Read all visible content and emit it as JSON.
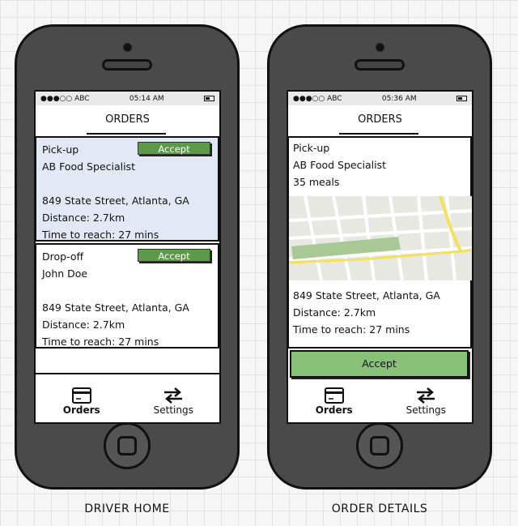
{
  "home": {
    "caption": "DRIVER HOME",
    "status": {
      "signal": "●●●○○ ABC",
      "time": "05:14 AM"
    },
    "title": "ORDERS",
    "pickup": {
      "type": "Pick-up",
      "accept": "Accept",
      "name": "AB Food Specialist",
      "address": "849 State Street, Atlanta, GA",
      "distance": "Distance: 2.7km",
      "time_to_reach": "Time to reach: 27 mins"
    },
    "dropoff": {
      "type": "Drop-off",
      "accept": "Accept",
      "name": "John Doe",
      "address": "849 State Street, Atlanta, GA",
      "distance": "Distance: 2.7km",
      "time_to_reach": "Time to reach: 27 mins"
    },
    "tabs": {
      "orders": "Orders",
      "settings": "Settings"
    }
  },
  "details": {
    "caption": "ORDER DETAILS",
    "status": {
      "signal": "●●●○○ ABC",
      "time": "05:36 AM"
    },
    "title": "ORDERS",
    "type": "Pick-up",
    "name": "AB Food Specialist",
    "meals": "35 meals",
    "address": "849 State Street, Atlanta, GA",
    "distance": "Distance: 2.7km",
    "time_to_reach": "Time to reach: 27 mins",
    "accept": "Accept",
    "tabs": {
      "orders": "Orders",
      "settings": "Settings"
    }
  },
  "icons": {
    "orders": "card-icon",
    "settings": "swap-arrows-icon",
    "battery": "battery-icon",
    "home": "home-button-icon"
  },
  "colors": {
    "accept_button": "#5c9a48",
    "accept_large": "#88c279",
    "selected_card": "#e3e9f4",
    "phone_body": "#4a4a4a"
  }
}
